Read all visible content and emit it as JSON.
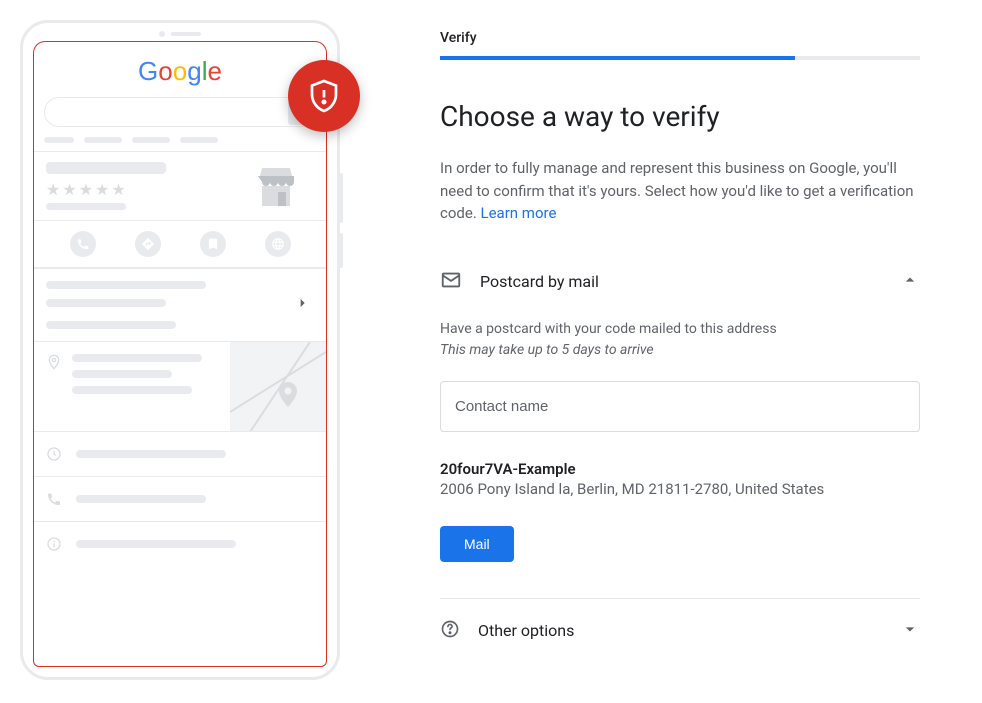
{
  "phone": {
    "logo": "Google",
    "shield_icon": "shield-alert"
  },
  "panel": {
    "step_label": "Verify",
    "progress_percent": 74,
    "heading": "Choose a way to verify",
    "description": "In order to fully manage and represent this business on Google, you'll need to confirm that it's yours. Select how you'd like to get a verification code.",
    "learn_more": "Learn more",
    "option_postcard": {
      "title": "Postcard by mail",
      "subtitle_line1": "Have a postcard with your code mailed to this address",
      "subtitle_line2": "This may take up to 5 days to arrive",
      "contact_placeholder": "Contact name",
      "business_name": "20four7VA-Example",
      "address": "2006 Pony Island la, Berlin, MD 21811-2780, United States",
      "button": "Mail"
    },
    "option_other": {
      "title": "Other options"
    }
  }
}
